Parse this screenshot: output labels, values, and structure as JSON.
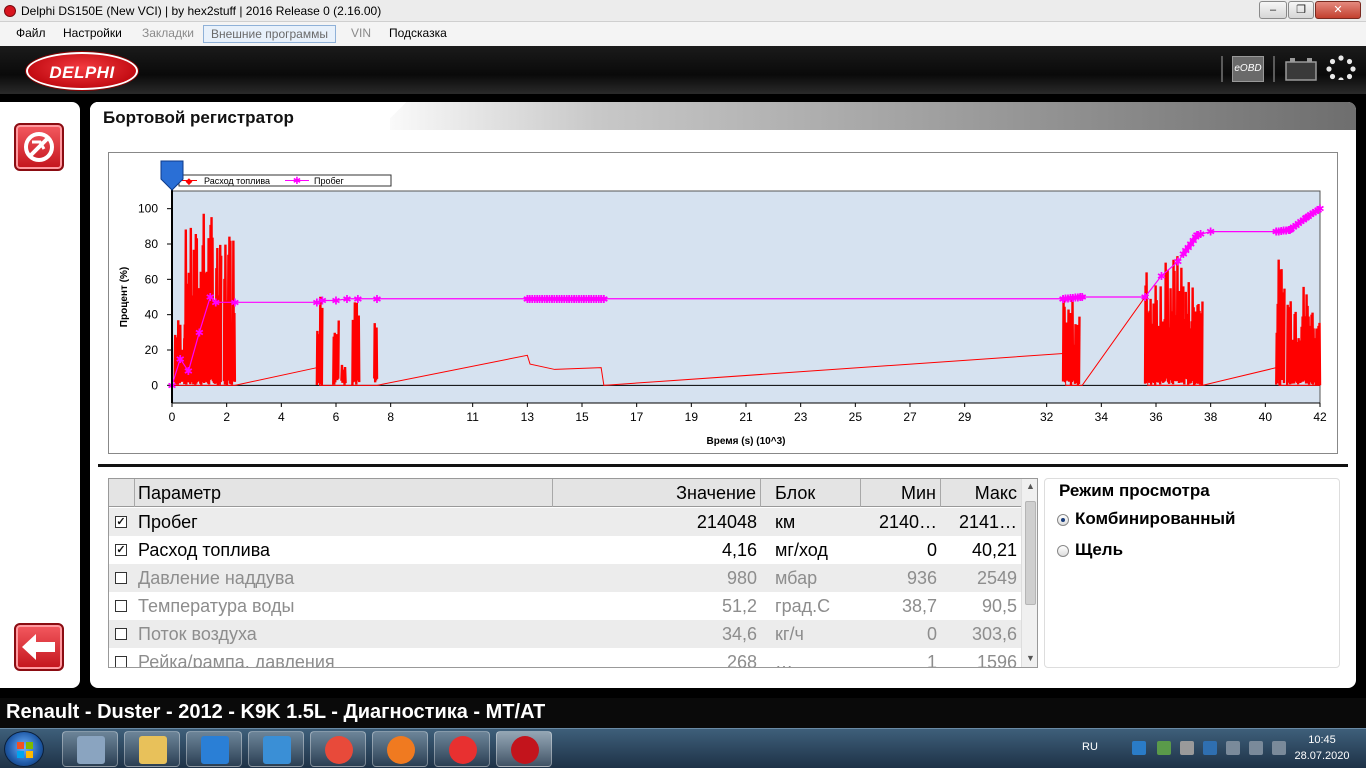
{
  "window": {
    "title": "Delphi DS150E (New VCI) | by hex2stuff | 2016 Release 0 (2.16.00)",
    "min_glyph": "‒",
    "max_glyph": "❐",
    "close_glyph": "✕"
  },
  "menu": {
    "items": [
      {
        "label": "Файл",
        "state": "normal"
      },
      {
        "label": "Настройки",
        "state": "normal"
      },
      {
        "label": "Закладки",
        "state": "disabled"
      },
      {
        "label": "Внешние программы",
        "state": "selected"
      },
      {
        "label": "VIN",
        "state": "disabled"
      },
      {
        "label": "Подсказка",
        "state": "normal"
      }
    ]
  },
  "header": {
    "logo_text": "DELPHI",
    "eobd_label": "eOBD",
    "icons": [
      "eobd-icon",
      "battery-icon",
      "settings-dots-icon"
    ]
  },
  "panel": {
    "title": "Бортовой регистратор"
  },
  "chart_data": {
    "type": "line",
    "xlabel": "Время (s) (10^3)",
    "ylabel": "Процент (%)",
    "xlim": [
      0,
      42
    ],
    "ylim": [
      -10,
      110
    ],
    "x_ticks": [
      0,
      2,
      4,
      6,
      8,
      11,
      13,
      15,
      17,
      19,
      21,
      23,
      25,
      27,
      29,
      32,
      34,
      36,
      38,
      40,
      42
    ],
    "y_ticks": [
      0,
      20,
      40,
      60,
      80,
      100
    ],
    "grid": false,
    "legend_position": "top-left",
    "background_color": "#d6e2f0",
    "cursor_x": 0,
    "series": [
      {
        "name": "Расход топлива",
        "color": "#ff0000",
        "marker": "diamond",
        "baseline": [
          [
            0,
            0
          ],
          [
            2.3,
            0
          ],
          [
            5.3,
            10
          ],
          [
            5.4,
            0
          ],
          [
            7.5,
            0
          ],
          [
            13,
            17
          ],
          [
            13.1,
            12
          ],
          [
            14,
            9
          ],
          [
            15.7,
            10
          ],
          [
            15.8,
            0
          ],
          [
            32.6,
            18
          ],
          [
            32.7,
            0
          ],
          [
            33.3,
            0
          ],
          [
            35.6,
            50
          ],
          [
            35.7,
            0
          ],
          [
            37.7,
            0
          ],
          [
            40.4,
            10
          ],
          [
            40.5,
            0
          ],
          [
            42,
            0
          ]
        ],
        "bursts": [
          {
            "x0": 0.1,
            "x1": 0.45,
            "peak": 40
          },
          {
            "x0": 0.45,
            "x1": 1.0,
            "peak": 90
          },
          {
            "x0": 1.0,
            "x1": 1.5,
            "peak": 100
          },
          {
            "x0": 1.5,
            "x1": 1.8,
            "peak": 80
          },
          {
            "x0": 1.9,
            "x1": 2.3,
            "peak": 92
          },
          {
            "x0": 5.3,
            "x1": 5.5,
            "peak": 58
          },
          {
            "x0": 5.9,
            "x1": 6.1,
            "peak": 45
          },
          {
            "x0": 6.2,
            "x1": 6.35,
            "peak": 22
          },
          {
            "x0": 6.6,
            "x1": 6.85,
            "peak": 50
          },
          {
            "x0": 7.4,
            "x1": 7.5,
            "peak": 38
          },
          {
            "x0": 32.6,
            "x1": 33.2,
            "peak": 50
          },
          {
            "x0": 35.6,
            "x1": 36.3,
            "peak": 68
          },
          {
            "x0": 36.3,
            "x1": 37.0,
            "peak": 75
          },
          {
            "x0": 37.0,
            "x1": 37.7,
            "peak": 63
          },
          {
            "x0": 40.4,
            "x1": 40.7,
            "peak": 73
          },
          {
            "x0": 40.8,
            "x1": 41.6,
            "peak": 60
          },
          {
            "x0": 41.6,
            "x1": 42.0,
            "peak": 50
          }
        ]
      },
      {
        "name": "Пробег",
        "color": "#ff00ff",
        "marker": "asterisk",
        "values": [
          [
            0,
            0
          ],
          [
            0.3,
            15
          ],
          [
            0.6,
            8
          ],
          [
            1.0,
            30
          ],
          [
            1.4,
            50
          ],
          [
            1.6,
            47
          ],
          [
            2.3,
            47
          ],
          [
            5.3,
            47
          ],
          [
            5.5,
            48
          ],
          [
            6.0,
            48
          ],
          [
            6.4,
            49
          ],
          [
            6.8,
            49
          ],
          [
            7.5,
            49
          ],
          [
            13.0,
            49
          ],
          [
            15.8,
            49
          ],
          [
            32.6,
            49
          ],
          [
            33.3,
            50
          ],
          [
            35.6,
            50
          ],
          [
            36.2,
            62
          ],
          [
            36.8,
            70
          ],
          [
            37.5,
            85
          ],
          [
            38,
            87
          ],
          [
            40.4,
            87
          ],
          [
            40.9,
            88
          ],
          [
            41.5,
            95
          ],
          [
            42,
            100
          ]
        ],
        "dense_segments": [
          [
            13.0,
            15.8
          ],
          [
            32.6,
            33.3
          ],
          [
            37.0,
            37.7
          ],
          [
            40.4,
            42.0
          ]
        ]
      }
    ]
  },
  "table": {
    "columns": [
      "Параметр",
      "Значение",
      "Блок",
      "Мин",
      "Макс"
    ],
    "rows": [
      {
        "checked": true,
        "name": "Пробег",
        "value": "214048",
        "unit": "км",
        "min": "2140…",
        "max": "2141…"
      },
      {
        "checked": true,
        "name": "Расход топлива",
        "value": "4,16",
        "unit": "мг/ход",
        "min": "0",
        "max": "40,21"
      },
      {
        "checked": false,
        "name": "Давление наддува",
        "value": "980",
        "unit": "мбар",
        "min": "936",
        "max": "2549"
      },
      {
        "checked": false,
        "name": "Температура воды",
        "value": "51,2",
        "unit": "град.С",
        "min": "38,7",
        "max": "90,5"
      },
      {
        "checked": false,
        "name": "Поток воздуха",
        "value": "34,6",
        "unit": "кг/ч",
        "min": "0",
        "max": "303,6"
      },
      {
        "checked": false,
        "name": "Рейка/рампа, давления",
        "value": "268",
        "unit": "…",
        "min": "1",
        "max": "1596"
      }
    ]
  },
  "view_mode": {
    "title": "Режим просмотра",
    "options": [
      {
        "label": "Комбинированный",
        "selected": true
      },
      {
        "label": "Щель",
        "selected": false
      }
    ]
  },
  "status": {
    "vehicle": "Renault - Duster - 2012 - K9K 1.5L - Диагностика - MT/AT"
  },
  "taskbar": {
    "apps": [
      "calculator-icon",
      "file-explorer-icon",
      "internet-explorer-icon",
      "keyboard-app-icon",
      "chrome-icon",
      "firefox-icon",
      "yandex-browser-icon",
      "delphi-app-icon"
    ],
    "language": "RU",
    "time": "10:45",
    "date": "28.07.2020"
  }
}
